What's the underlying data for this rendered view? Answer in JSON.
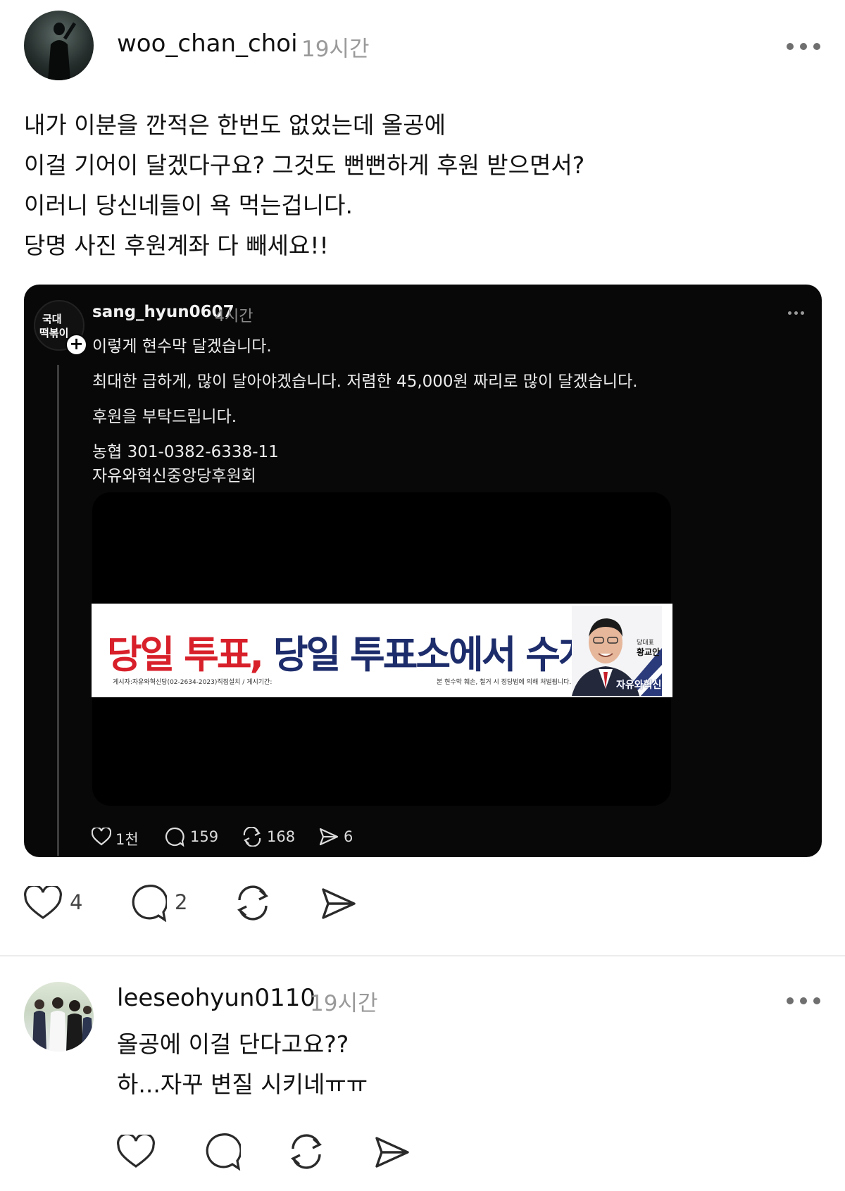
{
  "post": {
    "username": "woo_chan_choi",
    "time": "19시간",
    "lines": [
      "내가 이분을 깐적은 한번도 없었는데 올공에",
      "이걸 기어이 달겠다구요? 그것도 뻔뻔하게 후원 받으면서?",
      "이러니 당신네들이 욕 먹는겁니다.",
      "당명 사진 후원계좌 다 빼세요!!"
    ],
    "actions": {
      "likes": "4",
      "comments": "2"
    }
  },
  "quoted": {
    "avatar_text": [
      "국대",
      "떡볶이"
    ],
    "username": "sang_hyun0607",
    "time": "4시간",
    "lines": [
      "이렇게 현수막 달겠습니다.",
      "최대한 급하게, 많이 달아야겠습니다. 저렴한 45,000원 짜리로 많이 달겠습니다.",
      "후원을 부탁드립니다.",
      "농협 301-0382-6338-11",
      "자유와혁신중앙당후원회"
    ],
    "banner": {
      "title_red": "당일 투표,",
      "title_blue": "당일 투표소에서 수개표",
      "small_left": "게시자:자유와혁신당(02-2634-2023)직접설치 / 게시기간:",
      "small_right": "본 현수막 훼손, 철거 시 정당법에 의해 처벌됩니다.",
      "role": "당대표",
      "person": "황교안",
      "party": "자유와혁신"
    },
    "stats": {
      "likes": "1천",
      "comments": "159",
      "reposts": "168",
      "shares": "6"
    }
  },
  "reply": {
    "username": "leeseohyun0110",
    "time": "19시간",
    "lines": [
      "올공에 이걸 단다고요??",
      "하...자꾸 변질 시키네ㅠㅠ"
    ]
  },
  "colors": {
    "banner_red": "#d8202a",
    "banner_blue": "#1d2c6b",
    "muted": "#9a9a9a"
  }
}
